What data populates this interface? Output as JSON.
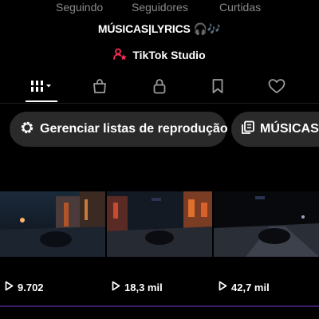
{
  "profile_stats": {
    "following_label": "Seguindo",
    "followers_label": "Seguidores",
    "likes_label": "Curtidas"
  },
  "bio": {
    "name": "MÚSICAS|LYRICS",
    "decoration": "🎧🎶"
  },
  "studio_button": {
    "label": "TikTok Studio",
    "icon": "person-star-icon",
    "icon_color": "#fe2c55"
  },
  "tabs": [
    {
      "name": "videos-grid",
      "icon": "grid-dropdown-icon",
      "active": true
    },
    {
      "name": "shop",
      "icon": "shopping-bag-icon",
      "active": false
    },
    {
      "name": "private",
      "icon": "lock-icon",
      "active": false
    },
    {
      "name": "saved",
      "icon": "bookmark-icon",
      "active": false
    },
    {
      "name": "liked",
      "icon": "heart-icon",
      "active": false
    }
  ],
  "playlists": [
    {
      "label": "Gerenciar listas de reprodução",
      "icon": "gear-icon"
    },
    {
      "label": "MÚSICAS L",
      "icon": "playlist-icon"
    }
  ],
  "videos": [
    {
      "views": "9.702"
    },
    {
      "views": "18,3 mil"
    },
    {
      "views": "42,7 mil"
    }
  ],
  "colors": {
    "background": "#000000",
    "chip_background": "#2a2a2a",
    "muted_text": "#8a8a8a",
    "accent_purple": "#8a5cf6",
    "studio_icon": "#fe2c55"
  }
}
